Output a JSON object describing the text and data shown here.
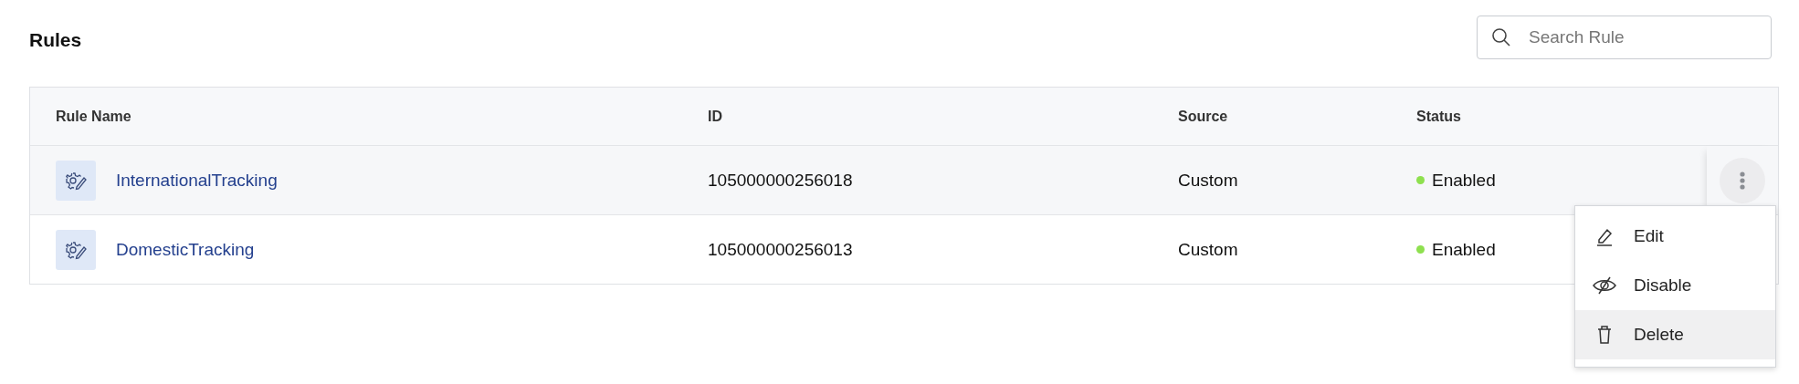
{
  "page": {
    "title": "Rules"
  },
  "search": {
    "placeholder": "Search Rule"
  },
  "table": {
    "columns": [
      "Rule Name",
      "ID",
      "Source",
      "Status"
    ],
    "rows": [
      {
        "name": "InternationalTracking",
        "id": "105000000256018",
        "source": "Custom",
        "status": "Enabled",
        "highlighted": true
      },
      {
        "name": "DomesticTracking",
        "id": "105000000256013",
        "source": "Custom",
        "status": "Enabled",
        "highlighted": false
      }
    ]
  },
  "menu": {
    "items": [
      {
        "label": "Edit",
        "kind": "edit",
        "highlighted": false
      },
      {
        "label": "Disable",
        "kind": "disable",
        "highlighted": false
      },
      {
        "label": "Delete",
        "kind": "delete",
        "highlighted": true
      }
    ]
  }
}
